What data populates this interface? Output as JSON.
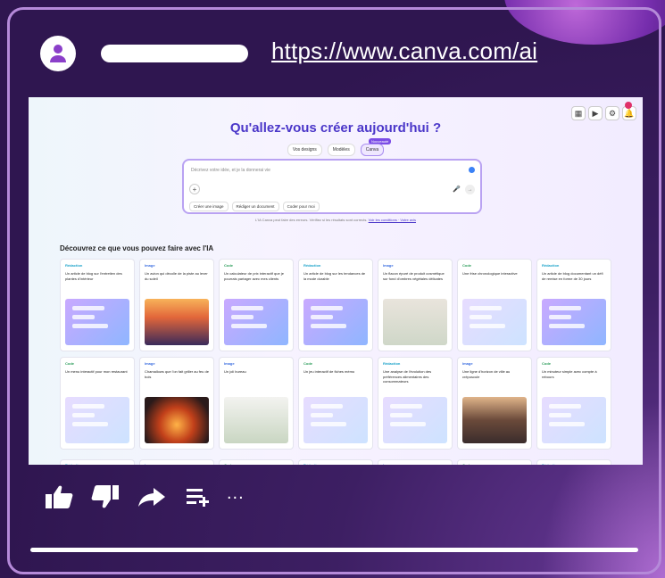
{
  "post": {
    "url": "https://www.canva.com/ai",
    "avatar_icon": "user-icon"
  },
  "screenshot": {
    "title": "Qu'allez-vous créer aujourd'hui ?",
    "chips": [
      "Vos designs",
      "Modèles",
      "Canva"
    ],
    "new_tag": "Nouveauté",
    "prompt_placeholder": "Décrivez votre idée, et je la donnerai vie",
    "actions": [
      "Créer une image",
      "Rédiger un document",
      "Coder pour moi"
    ],
    "disclaimer": "L'IA Canva peut faire des erreurs. Vérifiez si les résultats sont corrects.",
    "disclaimer_links": "Voir les conditions · Votre avis",
    "section_title": "Découvrez ce que vous pouvez faire avec l'IA",
    "cards": [
      {
        "category": "Rédaction",
        "text": "Un article de blog sur l'entretien des plantes d'intérieur"
      },
      {
        "category": "Image",
        "text": "Un avion qui décolle de la piste au lever du soleil"
      },
      {
        "category": "Code",
        "text": "Un calculateur de prix interactif que je pourrais partager avec mes clients"
      },
      {
        "category": "Rédaction",
        "text": "Un article de blog sur les tendances de la mode durable"
      },
      {
        "category": "Image",
        "text": "Un flacon épuré de produit cosmétique sur fond d'ombres végétales délicates"
      },
      {
        "category": "Code",
        "text": "Une frise chronologique interactive"
      },
      {
        "category": "Rédaction",
        "text": "Un article de blog documentant un défi de remise en forme de 30 jours"
      },
      {
        "category": "Code",
        "text": "Un menu interactif pour mon restaurant"
      },
      {
        "category": "Image",
        "text": "Chamallows que l'on fait griller au feu de bois"
      },
      {
        "category": "Image",
        "text": "Un joli bureau"
      },
      {
        "category": "Code",
        "text": "Un jeu interactif de fiches mémo"
      },
      {
        "category": "Rédaction",
        "text": "Une analyse de l'évolution des préférences alimentaires des consommateurs"
      },
      {
        "category": "Image",
        "text": "Une ligne d'horizon de ville au crépuscule"
      },
      {
        "category": "Code",
        "text": "Un minuteur simple avec compte à rebours"
      }
    ],
    "bottom_row_categories": [
      "Rédaction",
      "Image",
      "Code",
      "Rédaction",
      "Image",
      "Code",
      "Rédaction"
    ]
  },
  "controls": {
    "like_icon": "thumbs-up-icon",
    "dislike_icon": "thumbs-down-icon",
    "share_icon": "share-arrow-icon",
    "save_icon": "add-to-playlist-icon",
    "more_label": "..."
  },
  "progress": {
    "value": 1.0
  },
  "colors": {
    "accent": "#4b37c9",
    "frame": "#b58ad9",
    "background": "#3a1d5c"
  }
}
